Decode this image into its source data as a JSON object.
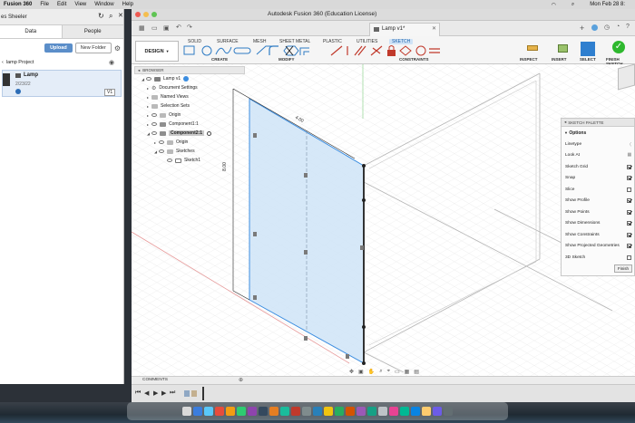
{
  "menubar": {
    "app_name": "Fusion 360",
    "items": [
      "File",
      "Edit",
      "View",
      "Window",
      "Help"
    ],
    "clock": "Mon Feb 28 8:"
  },
  "data_panel": {
    "title": "es Sheeler",
    "tabs": [
      "Data",
      "People"
    ],
    "upload_label": "Upload",
    "new_folder_label": "New Folder",
    "project_name": "lamp Project",
    "file": {
      "name": "Lamp",
      "date": "2/23/22",
      "version": "V1"
    }
  },
  "window": {
    "title": "Autodesk Fusion 360 (Education License)",
    "document_tab": "Lamp v1*"
  },
  "ribbon": {
    "workspace": "DESIGN",
    "tabs": [
      "SOLID",
      "SURFACE",
      "MESH",
      "SHEET METAL",
      "PLASTIC",
      "UTILITIES",
      "SKETCH"
    ],
    "active_tab": "SKETCH",
    "groups": [
      "CREATE",
      "MODIFY",
      "CONSTRAINTS",
      "INSPECT",
      "INSERT",
      "SELECT",
      "FINISH SKETCH"
    ]
  },
  "browser": {
    "title": "BROWSER",
    "rows": [
      {
        "label": "Lamp v1",
        "level": 0
      },
      {
        "label": "Document Settings",
        "level": 1
      },
      {
        "label": "Named Views",
        "level": 1
      },
      {
        "label": "Selection Sets",
        "level": 1
      },
      {
        "label": "Origin",
        "level": 1
      },
      {
        "label": "Component1:1",
        "level": 1
      },
      {
        "label": "Component2:1",
        "level": 1
      },
      {
        "label": "Origin",
        "level": 2
      },
      {
        "label": "Sketches",
        "level": 2
      },
      {
        "label": "Sketch1",
        "level": 3
      }
    ]
  },
  "sketch_palette": {
    "title": "SKETCH PALETTE",
    "section": "Options",
    "rows": [
      {
        "label": "Linetype",
        "kind": "icon"
      },
      {
        "label": "Look At",
        "kind": "icon"
      },
      {
        "label": "Sketch Grid",
        "kind": "check",
        "checked": true
      },
      {
        "label": "Snap",
        "kind": "check",
        "checked": true
      },
      {
        "label": "Slice",
        "kind": "check",
        "checked": false
      },
      {
        "label": "Show Profile",
        "kind": "check",
        "checked": true
      },
      {
        "label": "Show Points",
        "kind": "check",
        "checked": true
      },
      {
        "label": "Show Dimensions",
        "kind": "check",
        "checked": true
      },
      {
        "label": "Show Constraints",
        "kind": "check",
        "checked": true
      },
      {
        "label": "Show Projected Geometries",
        "kind": "check",
        "checked": true
      },
      {
        "label": "3D Sketch",
        "kind": "check",
        "checked": false
      }
    ],
    "finish_label": "Finish"
  },
  "dimensions": {
    "top": "4.00",
    "side": "8.00"
  },
  "comments_label": "COMMENTS",
  "colors": {
    "accent": "#0696d7",
    "finish_green": "#2eb82e",
    "profile_fill": "#cfe4f7",
    "sketch_line": "#1d1d1d"
  }
}
